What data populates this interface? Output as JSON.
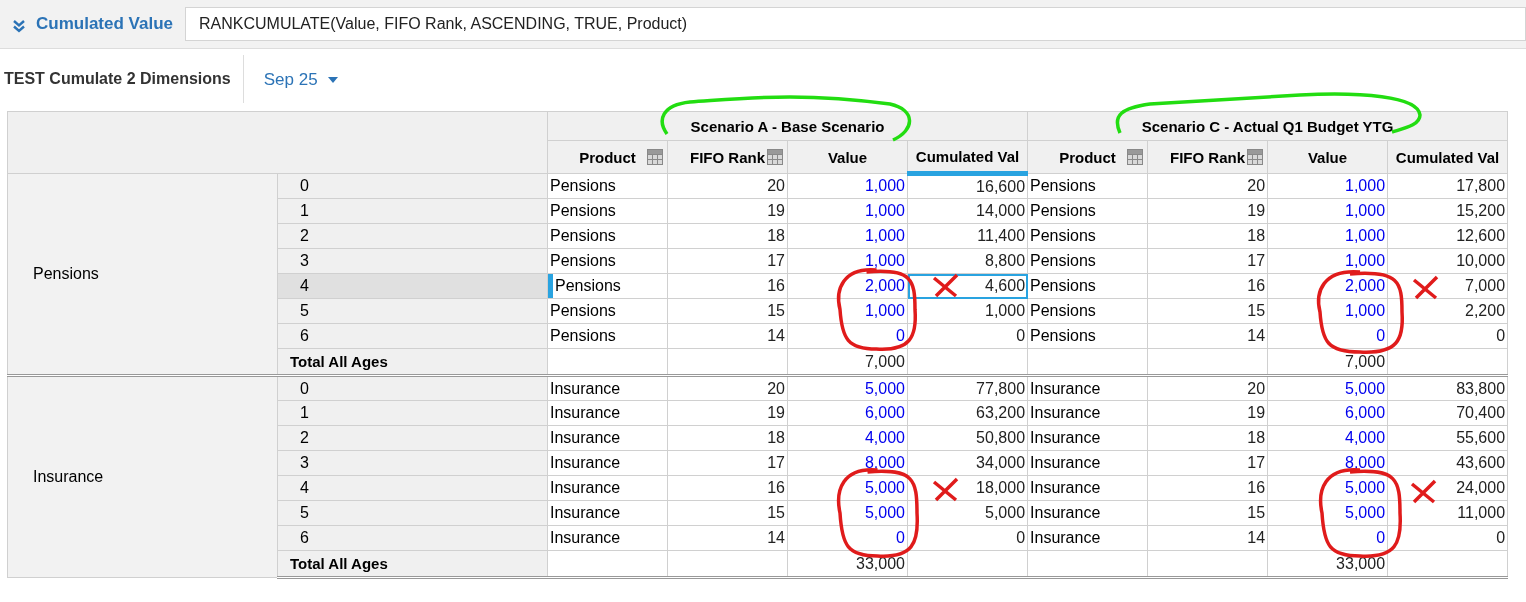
{
  "formula_bar": {
    "label": "Cumulated Value",
    "formula": "RANKCUMULATE(Value, FIFO Rank, ASCENDING, TRUE, Product)"
  },
  "view": {
    "title": "TEST Cumulate 2 Dimensions",
    "period": "Sep 25"
  },
  "scenarios": [
    "Scenario A - Base Scenario",
    "Scenario C - Actual Q1 Budget YTG"
  ],
  "columns": [
    {
      "label": "Product",
      "kind": "text",
      "filter_icon": true,
      "selected": false
    },
    {
      "label": "FIFO Rank",
      "kind": "number",
      "filter_icon": true,
      "selected": false
    },
    {
      "label": "Value",
      "kind": "input",
      "filter_icon": false,
      "selected": false
    },
    {
      "label": "Cumulated Val",
      "kind": "number",
      "filter_icon": false,
      "selected": true
    },
    {
      "label": "Product",
      "kind": "text",
      "filter_icon": true,
      "selected": false
    },
    {
      "label": "FIFO Rank",
      "kind": "number",
      "filter_icon": true,
      "selected": false
    },
    {
      "label": "Value",
      "kind": "input",
      "filter_icon": false,
      "selected": false
    },
    {
      "label": "Cumulated Val",
      "kind": "number",
      "filter_icon": false,
      "selected": false
    }
  ],
  "groups": [
    {
      "label": "Pensions",
      "total_label": "Total All Ages",
      "totals": [
        "7,000",
        "7,000"
      ],
      "rows": [
        {
          "age": "0",
          "selected": false,
          "cells": [
            "Pensions",
            "20",
            "1,000",
            "16,600",
            "Pensions",
            "20",
            "1,000",
            "17,800"
          ]
        },
        {
          "age": "1",
          "selected": false,
          "cells": [
            "Pensions",
            "19",
            "1,000",
            "14,000",
            "Pensions",
            "19",
            "1,000",
            "15,200"
          ]
        },
        {
          "age": "2",
          "selected": false,
          "cells": [
            "Pensions",
            "18",
            "1,000",
            "11,400",
            "Pensions",
            "18",
            "1,000",
            "12,600"
          ]
        },
        {
          "age": "3",
          "selected": false,
          "cells": [
            "Pensions",
            "17",
            "1,000",
            "8,800",
            "Pensions",
            "17",
            "1,000",
            "10,000"
          ]
        },
        {
          "age": "4",
          "selected": true,
          "cells": [
            "Pensions",
            "16",
            "2,000",
            "4,600",
            "Pensions",
            "16",
            "2,000",
            "7,000"
          ]
        },
        {
          "age": "5",
          "selected": false,
          "cells": [
            "Pensions",
            "15",
            "1,000",
            "1,000",
            "Pensions",
            "15",
            "1,000",
            "2,200"
          ]
        },
        {
          "age": "6",
          "selected": false,
          "cells": [
            "Pensions",
            "14",
            "0",
            "0",
            "Pensions",
            "14",
            "0",
            "0"
          ]
        }
      ]
    },
    {
      "label": "Insurance",
      "total_label": "Total All Ages",
      "totals": [
        "33,000",
        "33,000"
      ],
      "rows": [
        {
          "age": "0",
          "selected": false,
          "cells": [
            "Insurance",
            "20",
            "5,000",
            "77,800",
            "Insurance",
            "20",
            "5,000",
            "83,800"
          ]
        },
        {
          "age": "1",
          "selected": false,
          "cells": [
            "Insurance",
            "19",
            "6,000",
            "63,200",
            "Insurance",
            "19",
            "6,000",
            "70,400"
          ]
        },
        {
          "age": "2",
          "selected": false,
          "cells": [
            "Insurance",
            "18",
            "4,000",
            "50,800",
            "Insurance",
            "18",
            "4,000",
            "55,600"
          ]
        },
        {
          "age": "3",
          "selected": false,
          "cells": [
            "Insurance",
            "17",
            "8,000",
            "34,000",
            "Insurance",
            "17",
            "8,000",
            "43,600"
          ]
        },
        {
          "age": "4",
          "selected": false,
          "cells": [
            "Insurance",
            "16",
            "5,000",
            "18,000",
            "Insurance",
            "16",
            "5,000",
            "24,000"
          ]
        },
        {
          "age": "5",
          "selected": false,
          "cells": [
            "Insurance",
            "15",
            "5,000",
            "5,000",
            "Insurance",
            "15",
            "5,000",
            "11,000"
          ]
        },
        {
          "age": "6",
          "selected": false,
          "cells": [
            "Insurance",
            "14",
            "0",
            "0",
            "Insurance",
            "14",
            "0",
            "0"
          ]
        }
      ]
    }
  ]
}
